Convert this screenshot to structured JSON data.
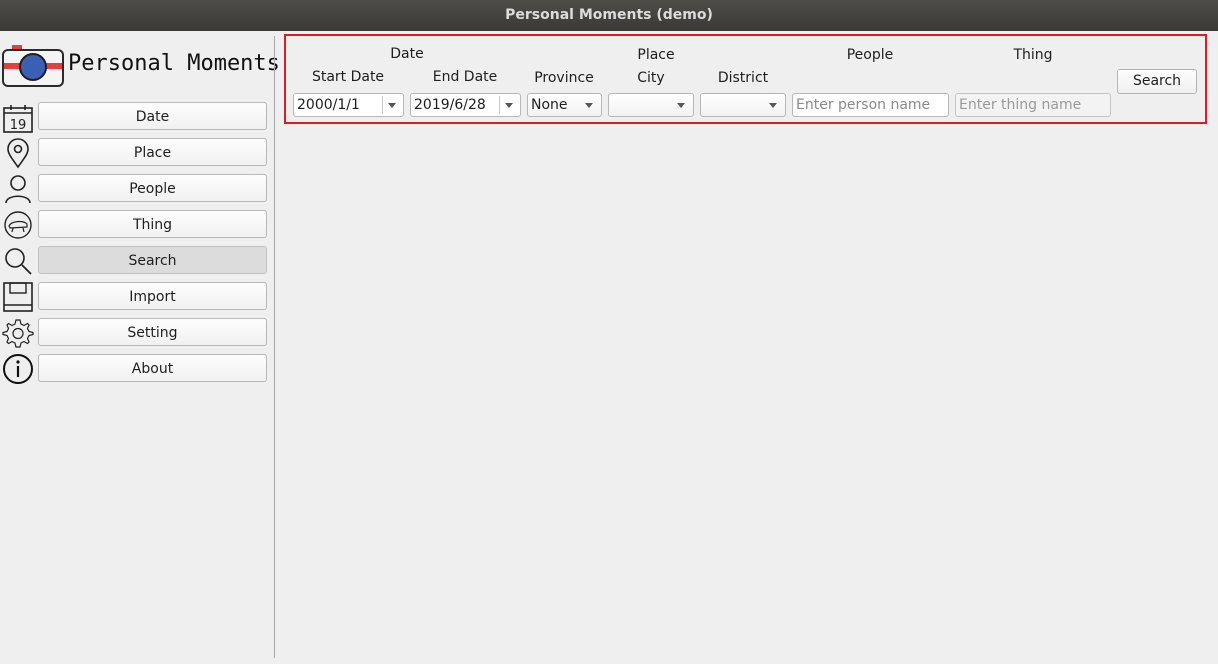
{
  "window": {
    "title": "Personal Moments (demo)"
  },
  "app": {
    "name": "Personal Moments"
  },
  "sidebar": {
    "items": [
      {
        "label": "Date",
        "icon": "calendar-icon",
        "icon_text": "19"
      },
      {
        "label": "Place",
        "icon": "location-pin-icon"
      },
      {
        "label": "People",
        "icon": "person-icon"
      },
      {
        "label": "Thing",
        "icon": "thing-icon"
      },
      {
        "label": "Search",
        "icon": "search-icon"
      },
      {
        "label": "Import",
        "icon": "save-icon"
      },
      {
        "label": "Setting",
        "icon": "gear-icon"
      },
      {
        "label": "About",
        "icon": "info-icon"
      }
    ],
    "active": "Search"
  },
  "search_panel": {
    "date_header": "Date",
    "start_date_label": "Start Date",
    "start_date_value": "2000/1/1",
    "end_date_label": "End Date",
    "end_date_value": "2019/6/28",
    "place_header": "Place",
    "province_label": "Province",
    "province_value": "None",
    "city_label": "City",
    "city_value": "",
    "district_label": "District",
    "district_value": "",
    "people_header": "People",
    "person_placeholder": "Enter person name",
    "thing_header": "Thing",
    "thing_placeholder": "Enter thing name",
    "search_button": "Search"
  },
  "colors": {
    "highlight_border": "#e01b24",
    "titlebar": "#3c3b37",
    "logo_blue": "#3b5fb5",
    "logo_red": "#e2403f"
  }
}
